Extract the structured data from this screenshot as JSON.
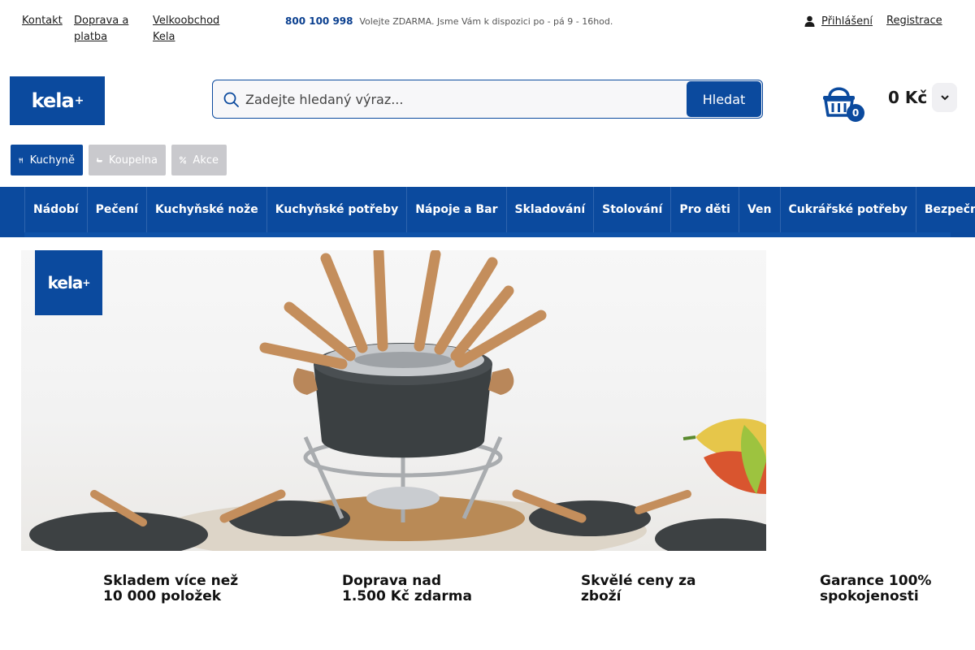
{
  "topbar": {
    "contact_label": "Kontakt",
    "shipping_label": "Doprava a platba",
    "wholesale_label": "Velkoobchod Kela",
    "phone_number": "800 100 998",
    "phone_note": "Volejte ZDARMA. Jsme Vám k dispozici po - pá 9 - 16hod.",
    "login_label": "Přihlášení",
    "register_label": "Registrace"
  },
  "header": {
    "logo_text": "kela",
    "search": {
      "placeholder": "Zadejte hledaný výraz...",
      "value": "",
      "button_label": "Hledat"
    },
    "cart": {
      "count": "0",
      "total": "0 Kč"
    }
  },
  "section_tabs": [
    {
      "label": "Kuchyně",
      "icon": "cutlery-icon",
      "active": true
    },
    {
      "label": "Koupelna",
      "icon": "bathtub-icon",
      "active": false
    },
    {
      "label": "Akce",
      "icon": "percent-icon",
      "active": false
    }
  ],
  "categories": [
    "Nádobí",
    "Pečení",
    "Kuchyňské nože",
    "Kuchyňské potřeby",
    "Nápoje a Bar",
    "Skladování",
    "Stolování",
    "Pro děti",
    "Ven",
    "Cukrářské potřeby",
    "Bezpečnost"
  ],
  "banner": {
    "logo_text": "kela",
    "image": "fondue-set-product-photo"
  },
  "benefits": [
    "Skladem více než 10 000 položek",
    "Doprava nad 1.500 Kč zdarma",
    "Skvělé ceny za zboží",
    "Garance 100% spokojenosti"
  ],
  "colors": {
    "brand_blue": "#0b4a9e",
    "inactive_tab": "#c9c9cd"
  }
}
